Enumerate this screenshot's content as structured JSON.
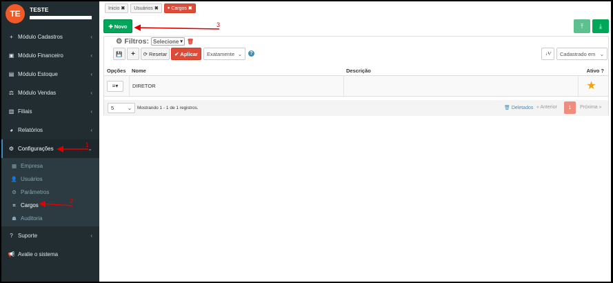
{
  "user": {
    "initials": "TE",
    "name": "TESTE"
  },
  "sidebar": {
    "items": [
      {
        "label": "Módulo Cadastros",
        "icon": "+"
      },
      {
        "label": "Módulo Financeiro",
        "icon": "▣"
      },
      {
        "label": "Módulo Estoque",
        "icon": "▤"
      },
      {
        "label": "Módulo Vendas",
        "icon": "⚖"
      },
      {
        "label": "Filiais",
        "icon": "▥"
      },
      {
        "label": "Relatórios",
        "icon": "◕"
      },
      {
        "label": "Configurações",
        "icon": "⚙"
      },
      {
        "label": "Suporte",
        "icon": "?"
      },
      {
        "label": "Avalie o sistema",
        "icon": "📢"
      }
    ],
    "submenu": [
      {
        "label": "Empresa",
        "icon": "▦"
      },
      {
        "label": "Usuários",
        "icon": "👤"
      },
      {
        "label": "Parâmetros",
        "icon": "⚙"
      },
      {
        "label": "Cargos",
        "icon": "⌗"
      },
      {
        "label": "Auditoria",
        "icon": "☗"
      }
    ]
  },
  "tabs": [
    {
      "label": "Inicio"
    },
    {
      "label": "Usuários"
    },
    {
      "label": "Cargos"
    }
  ],
  "toolbar": {
    "novo_label": "Novo",
    "filters_label": "Filtros:",
    "filter_select": "Selecione",
    "reset_label": "Resetar",
    "apply_label": "Aplicar",
    "match_mode": "Exatamente",
    "order_by": "Cadastrado em"
  },
  "table": {
    "headers": {
      "options": "Opções",
      "name": "Nome",
      "description": "Descrição",
      "active": "Ativo ?"
    },
    "rows": [
      {
        "name": "DIRETOR",
        "description": ""
      }
    ]
  },
  "footer": {
    "page_size": "5",
    "records": "Mostrando 1 - 1 de 1 registros.",
    "deleted": "Deletados",
    "prev": "« Anterior",
    "current_page": "1",
    "next": "Próxima »"
  },
  "annotations": {
    "one": "1",
    "two": "2",
    "three": "3"
  },
  "colors": {
    "sidebar": "#222d32",
    "primary_green": "#00a65a",
    "danger_red": "#dd4b39",
    "link_blue": "#3c8dbc",
    "star": "#f0a30a"
  }
}
